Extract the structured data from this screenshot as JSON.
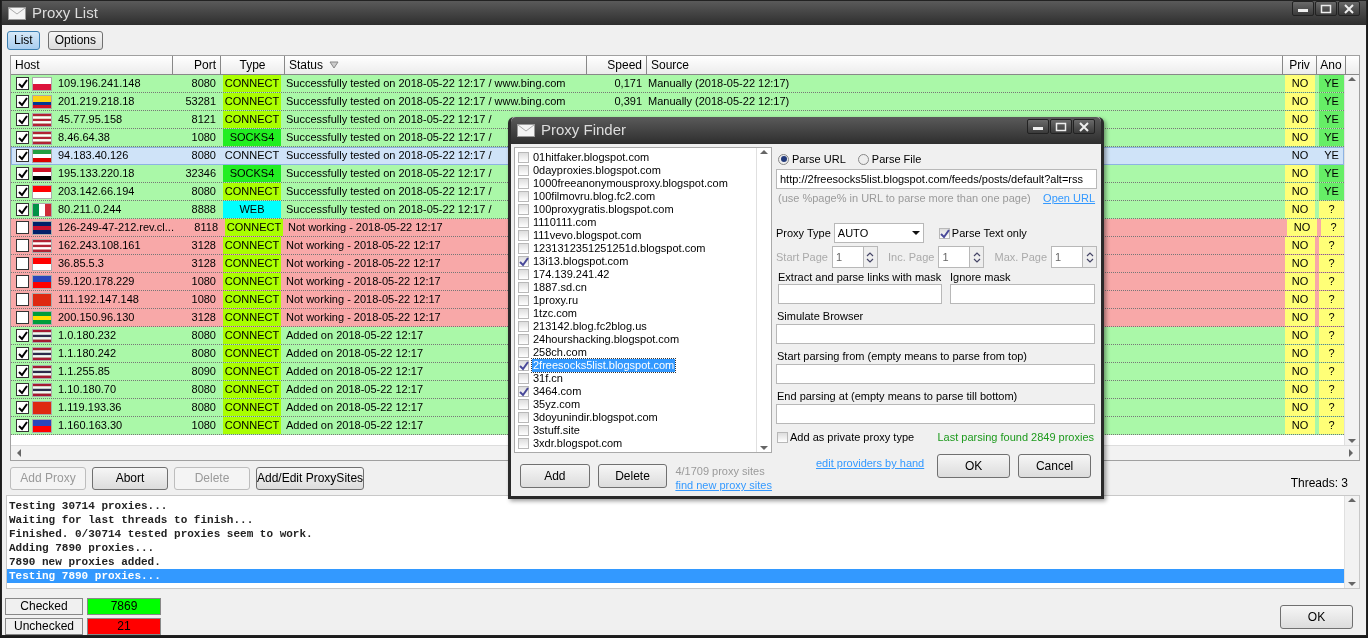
{
  "window": {
    "title": "Proxy List"
  },
  "view_tabs": [
    {
      "label": "List",
      "selected": true
    },
    {
      "label": "Options",
      "selected": false
    }
  ],
  "table": {
    "columns": [
      {
        "label": "Host",
        "sorted": false
      },
      {
        "label": "Port",
        "sorted": false
      },
      {
        "label": "Type",
        "sorted": false
      },
      {
        "label": "Status",
        "sorted": true
      },
      {
        "label": "Speed",
        "sorted": false
      },
      {
        "label": "Source",
        "sorted": false
      },
      {
        "label": "Priv",
        "sorted": false
      },
      {
        "label": "Ano",
        "sorted": false
      }
    ],
    "rows": [
      {
        "checked": true,
        "flag": {
          "vertical": false,
          "stripes": [
            {
              "color": "#ffffff"
            },
            {
              "color": "#dc143c"
            }
          ]
        },
        "host": "109.196.241.148",
        "port": "8080",
        "type": {
          "label": "CONNECT",
          "color": "#aaff00"
        },
        "status": "Successfully tested on 2018-05-22 12:17 / www.bing.com",
        "speed": "0,171",
        "source": "Manually (2018-05-22 12:17)",
        "priv": "NO",
        "ano": {
          "label": "YE",
          "color": "#66ee66"
        },
        "color": "#aaf8a8",
        "selected": false
      },
      {
        "checked": true,
        "flag": {
          "vertical": false,
          "stripes": [
            {
              "color": "#fcd116"
            },
            {
              "color": "#fcd116"
            },
            {
              "color": "#003893"
            },
            {
              "color": "#ce1126"
            }
          ]
        },
        "host": "201.219.218.18",
        "port": "53281",
        "type": {
          "label": "CONNECT",
          "color": "#aaff00"
        },
        "status": "Successfully tested on 2018-05-22 12:17 / www.bing.com",
        "speed": "0,391",
        "source": "Manually (2018-05-22 12:17)",
        "priv": "NO",
        "ano": {
          "label": "YE",
          "color": "#66ee66"
        },
        "color": "#aaf8a8",
        "selected": false
      },
      {
        "checked": true,
        "flag": {
          "vertical": false,
          "stripes": [
            {
              "color": "#b22234"
            },
            {
              "color": "#ffffff"
            },
            {
              "color": "#b22234"
            },
            {
              "color": "#ffffff"
            },
            {
              "color": "#b22234"
            }
          ]
        },
        "host": "45.77.95.158",
        "port": "8121",
        "type": {
          "label": "CONNECT",
          "color": "#aaff00"
        },
        "status": "Successfully tested on 2018-05-22 12:17 /",
        "priv": "NO",
        "ano": {
          "label": "YE",
          "color": "#66ee66"
        },
        "color": "#aaf8a8",
        "selected": false
      },
      {
        "checked": true,
        "flag": {
          "vertical": false,
          "stripes": [
            {
              "color": "#b22234"
            },
            {
              "color": "#ffffff"
            },
            {
              "color": "#b22234"
            },
            {
              "color": "#ffffff"
            },
            {
              "color": "#b22234"
            }
          ]
        },
        "host": "8.46.64.38",
        "port": "1080",
        "type": {
          "label": "SOCKS4",
          "color": "#22ee22"
        },
        "status": "Successfully tested on 2018-05-22 12:17 /",
        "priv": "NO",
        "ano": {
          "label": "YE",
          "color": "#66ee66"
        },
        "color": "#aaf8a8",
        "selected": false
      },
      {
        "checked": true,
        "flag": {
          "vertical": false,
          "stripes": [
            {
              "color": "#239f40"
            },
            {
              "color": "#ffffff"
            },
            {
              "color": "#da0000"
            }
          ]
        },
        "host": "94.183.40.126",
        "port": "8080",
        "type": {
          "label": "CONNECT"
        },
        "status": "Successfully tested on 2018-05-22 12:17 /",
        "priv": "NO",
        "ano": {
          "label": "YE"
        },
        "selected": true
      },
      {
        "checked": true,
        "flag": {
          "vertical": false,
          "stripes": [
            {
              "color": "#ce1126"
            },
            {
              "color": "#ffffff"
            },
            {
              "color": "#000000"
            }
          ]
        },
        "host": "195.133.220.18",
        "port": "32346",
        "type": {
          "label": "SOCKS4",
          "color": "#22ee22"
        },
        "status": "Successfully tested on 2018-05-22 12:17 /",
        "priv": "NO",
        "ano": {
          "label": "YE",
          "color": "#66ee66"
        },
        "color": "#aaf8a8",
        "selected": false
      },
      {
        "checked": true,
        "flag": {
          "vertical": false,
          "stripes": [
            {
              "color": "#ff0000"
            },
            {
              "color": "#ffffff"
            }
          ]
        },
        "host": "203.142.66.194",
        "port": "8080",
        "type": {
          "label": "CONNECT",
          "color": "#aaff00"
        },
        "status": "Successfully tested on 2018-05-22 12:17 /",
        "priv": "NO",
        "ano": {
          "label": "YE",
          "color": "#66ee66"
        },
        "color": "#aaf8a8",
        "selected": false
      },
      {
        "checked": true,
        "flag": {
          "vertical": true,
          "stripes": [
            {
              "color": "#009246"
            },
            {
              "color": "#ffffff"
            },
            {
              "color": "#ce2b37"
            }
          ]
        },
        "host": "80.211.0.244",
        "port": "8888",
        "type": {
          "label": "WEB",
          "color": "#00ffff"
        },
        "status": "Successfully tested on 2018-05-22 12:17 /",
        "priv": "NO",
        "ano": {
          "label": "?",
          "color": "#ffff77"
        },
        "color": "#aaf8a8",
        "selected": false
      },
      {
        "checked": false,
        "flag": {
          "vertical": false,
          "stripes": [
            {
              "color": "#012169"
            },
            {
              "color": "#c8102e"
            },
            {
              "color": "#012169"
            }
          ]
        },
        "host": "126-249-47-212.rev.cl...",
        "port": "8118",
        "type": {
          "label": "CONNECT",
          "color": "#aaff00"
        },
        "status": "Not working - 2018-05-22 12:17",
        "priv": "NO",
        "ano": {
          "label": "?",
          "color": "#ffff77"
        },
        "color": "#f8a8a8",
        "selected": false
      },
      {
        "checked": false,
        "flag": {
          "vertical": false,
          "stripes": [
            {
              "color": "#b22234"
            },
            {
              "color": "#ffffff"
            },
            {
              "color": "#b22234"
            },
            {
              "color": "#ffffff"
            },
            {
              "color": "#b22234"
            }
          ]
        },
        "host": "162.243.108.161",
        "port": "3128",
        "type": {
          "label": "CONNECT",
          "color": "#aaff00"
        },
        "status": "Not working - 2018-05-22 12:17",
        "priv": "NO",
        "ano": {
          "label": "?",
          "color": "#ffff77"
        },
        "color": "#f8a8a8",
        "selected": false
      },
      {
        "checked": false,
        "flag": {
          "vertical": false,
          "stripes": [
            {
              "color": "#ff0000"
            },
            {
              "color": "#ffffff"
            }
          ]
        },
        "host": "36.85.5.3",
        "port": "3128",
        "type": {
          "label": "CONNECT",
          "color": "#aaff00"
        },
        "status": "Not working - 2018-05-22 12:17",
        "priv": "NO",
        "ano": {
          "label": "?",
          "color": "#ffff77"
        },
        "color": "#f8a8a8",
        "selected": false
      },
      {
        "checked": false,
        "flag": {
          "vertical": false,
          "stripes": [
            {
              "color": "#2845bb"
            },
            {
              "color": "#fe0000"
            }
          ]
        },
        "host": "59.120.178.229",
        "port": "1080",
        "type": {
          "label": "CONNECT",
          "color": "#aaff00"
        },
        "status": "Not working - 2018-05-22 12:17",
        "priv": "NO",
        "ano": {
          "label": "?",
          "color": "#ffff77"
        },
        "color": "#f8a8a8",
        "selected": false
      },
      {
        "checked": false,
        "flag": {
          "stripes": [
            {
              "color": "#de2910"
            }
          ]
        },
        "host": "111.192.147.148",
        "port": "1080",
        "type": {
          "label": "CONNECT",
          "color": "#aaff00"
        },
        "status": "Not working - 2018-05-22 12:17",
        "priv": "NO",
        "ano": {
          "label": "?",
          "color": "#ffff77"
        },
        "color": "#f8a8a8",
        "selected": false
      },
      {
        "checked": false,
        "flag": {
          "vertical": false,
          "stripes": [
            {
              "color": "#009c3b"
            },
            {
              "color": "#ffdf00"
            },
            {
              "color": "#009c3b"
            }
          ]
        },
        "host": "200.150.96.130",
        "port": "3128",
        "type": {
          "label": "CONNECT",
          "color": "#aaff00"
        },
        "status": "Not working - 2018-05-22 12:17",
        "priv": "NO",
        "ano": {
          "label": "?",
          "color": "#ffff77"
        },
        "color": "#f8a8a8",
        "selected": false
      },
      {
        "checked": true,
        "flag": {
          "vertical": false,
          "stripes": [
            {
              "color": "#a51931"
            },
            {
              "color": "#f4f5f8"
            },
            {
              "color": "#2d2a4a"
            },
            {
              "color": "#f4f5f8"
            },
            {
              "color": "#a51931"
            }
          ]
        },
        "host": "1.0.180.232",
        "port": "8080",
        "type": {
          "label": "CONNECT",
          "color": "#aaff00"
        },
        "status": "Added on 2018-05-22 12:17",
        "priv": "NO",
        "ano": {
          "label": "?",
          "color": "#ffff77"
        },
        "color": "#aaf8a8",
        "selected": false
      },
      {
        "checked": true,
        "flag": {
          "vertical": false,
          "stripes": [
            {
              "color": "#a51931"
            },
            {
              "color": "#f4f5f8"
            },
            {
              "color": "#2d2a4a"
            },
            {
              "color": "#f4f5f8"
            },
            {
              "color": "#a51931"
            }
          ]
        },
        "host": "1.1.180.242",
        "port": "8080",
        "type": {
          "label": "CONNECT",
          "color": "#aaff00"
        },
        "status": "Added on 2018-05-22 12:17",
        "priv": "NO",
        "ano": {
          "label": "?",
          "color": "#ffff77"
        },
        "color": "#aaf8a8",
        "selected": false
      },
      {
        "checked": true,
        "flag": {
          "vertical": false,
          "stripes": [
            {
              "color": "#a51931"
            },
            {
              "color": "#f4f5f8"
            },
            {
              "color": "#2d2a4a"
            },
            {
              "color": "#f4f5f8"
            },
            {
              "color": "#a51931"
            }
          ]
        },
        "host": "1.1.255.85",
        "port": "8090",
        "type": {
          "label": "CONNECT",
          "color": "#aaff00"
        },
        "status": "Added on 2018-05-22 12:17",
        "priv": "NO",
        "ano": {
          "label": "?",
          "color": "#ffff77"
        },
        "color": "#aaf8a8",
        "selected": false
      },
      {
        "checked": true,
        "flag": {
          "vertical": false,
          "stripes": [
            {
              "color": "#a51931"
            },
            {
              "color": "#f4f5f8"
            },
            {
              "color": "#2d2a4a"
            },
            {
              "color": "#f4f5f8"
            },
            {
              "color": "#a51931"
            }
          ]
        },
        "host": "1.10.180.70",
        "port": "8080",
        "type": {
          "label": "CONNECT",
          "color": "#aaff00"
        },
        "status": "Added on 2018-05-22 12:17",
        "priv": "NO",
        "ano": {
          "label": "?",
          "color": "#ffff77"
        },
        "color": "#aaf8a8",
        "selected": false
      },
      {
        "checked": true,
        "flag": {
          "stripes": [
            {
              "color": "#de2910"
            }
          ]
        },
        "host": "1.119.193.36",
        "port": "8080",
        "type": {
          "label": "CONNECT",
          "color": "#aaff00"
        },
        "status": "Added on 2018-05-22 12:17",
        "priv": "NO",
        "ano": {
          "label": "?",
          "color": "#ffff77"
        },
        "color": "#aaf8a8",
        "selected": false
      },
      {
        "checked": true,
        "flag": {
          "vertical": false,
          "stripes": [
            {
              "color": "#2845bb"
            },
            {
              "color": "#fe0000"
            }
          ]
        },
        "host": "1.160.163.30",
        "port": "1080",
        "type": {
          "label": "CONNECT",
          "color": "#aaff00"
        },
        "status": "Added on 2018-05-22 12:17",
        "priv": "NO",
        "ano": {
          "label": "?",
          "color": "#ffff77"
        },
        "color": "#aaf8a8",
        "selected": false
      }
    ]
  },
  "buttons": [
    {
      "label": "Add Proxy",
      "disabled": true
    },
    {
      "label": "Abort",
      "disabled": false
    },
    {
      "label": "Delete",
      "disabled": true
    },
    {
      "label": "Add/Edit ProxySites",
      "disabled": false
    }
  ],
  "threads": "Threads: 3",
  "log": [
    {
      "text": "Testing 30714 proxies...",
      "selected": false
    },
    {
      "text": "Waiting for last threads to finish...",
      "selected": false
    },
    {
      "text": "Finished. 0/30714 tested proxies seem to work.",
      "selected": false
    },
    {
      "text": "Adding 7890 proxies...",
      "selected": false
    },
    {
      "text": "7890 new proxies added.",
      "selected": false
    },
    {
      "text": "Testing 7890 proxies...",
      "selected": true
    }
  ],
  "counters": [
    {
      "label": "Checked",
      "value": "7869",
      "color": "#00ff00"
    },
    {
      "label": "Unchecked",
      "value": "21",
      "color": "#ff0000"
    }
  ],
  "ok_button": "OK",
  "dialog": {
    "title": "Proxy Finder",
    "sites": [
      {
        "label": "01hitfaker.blogspot.com",
        "checked": false,
        "selected": false
      },
      {
        "label": "0dayproxies.blogspot.com",
        "checked": false,
        "selected": false
      },
      {
        "label": "1000freeanonymousproxy.blogspot.com",
        "checked": false,
        "selected": false
      },
      {
        "label": "100filmovru.blog.fc2.com",
        "checked": false,
        "selected": false
      },
      {
        "label": "100proxygratis.blogspot.com",
        "checked": false,
        "selected": false
      },
      {
        "label": "1110111.com",
        "checked": false,
        "selected": false
      },
      {
        "label": "111vevo.blogspot.com",
        "checked": false,
        "selected": false
      },
      {
        "label": "1231312351251251d.blogspot.com",
        "checked": false,
        "selected": false
      },
      {
        "label": "13i13.blogspot.com",
        "checked": true,
        "selected": false
      },
      {
        "label": "174.139.241.42",
        "checked": false,
        "selected": false
      },
      {
        "label": "1887.sd.cn",
        "checked": false,
        "selected": false
      },
      {
        "label": "1proxy.ru",
        "checked": false,
        "selected": false
      },
      {
        "label": "1tzc.com",
        "checked": false,
        "selected": false
      },
      {
        "label": "213142.blog.fc2blog.us",
        "checked": false,
        "selected": false
      },
      {
        "label": "24hourshacking.blogspot.com",
        "checked": false,
        "selected": false
      },
      {
        "label": "258ch.com",
        "checked": false,
        "selected": false
      },
      {
        "label": "2freesocks5list.blogspot.com",
        "checked": true,
        "selected": true
      },
      {
        "label": "31f.cn",
        "checked": false,
        "selected": false
      },
      {
        "label": "3464.com",
        "checked": true,
        "selected": false
      },
      {
        "label": "35yz.com",
        "checked": false,
        "selected": false
      },
      {
        "label": "3doyunindir.blogspot.com",
        "checked": false,
        "selected": false
      },
      {
        "label": "3stuff.site",
        "checked": false,
        "selected": false
      },
      {
        "label": "3xdr.blogspot.com",
        "checked": false,
        "selected": false
      }
    ],
    "add_button": "Add",
    "delete_button": "Delete",
    "site_count": "4/1709 proxy sites",
    "find_link": "find new proxy sites",
    "edit_link": "edit providers by hand",
    "source_modes": [
      {
        "label": "Parse URL",
        "selected": true
      },
      {
        "label": "Parse File",
        "selected": false
      }
    ],
    "url": "http://2freesocks5list.blogspot.com/feeds/posts/default?alt=rss",
    "url_hint": "(use %page% in URL to parse more than one page)",
    "open_url": "Open URL",
    "proxy_type": {
      "label": "Proxy Type",
      "value": "AUTO"
    },
    "parse_text_only": {
      "label": "Parse Text only",
      "checked": true
    },
    "pages": [
      {
        "label": "Start Page",
        "value": "1",
        "disabled": true
      },
      {
        "label": "Inc. Page",
        "value": "1",
        "disabled": true
      },
      {
        "label": "Max. Page",
        "value": "1",
        "disabled": true
      }
    ],
    "mask_fields": [
      {
        "label": "Extract and parse links with mask"
      },
      {
        "label": "Ignore mask"
      }
    ],
    "fields": [
      {
        "label": "Simulate Browser"
      },
      {
        "label": "Start parsing from (empty means to parse from top)"
      },
      {
        "label": "End parsing at (empty means to parse till bottom)"
      }
    ],
    "private_type": {
      "label": "Add as private proxy type",
      "checked": false
    },
    "result": "Last parsing found 2849 proxies",
    "ok_button": "OK",
    "cancel_button": "Cancel"
  }
}
